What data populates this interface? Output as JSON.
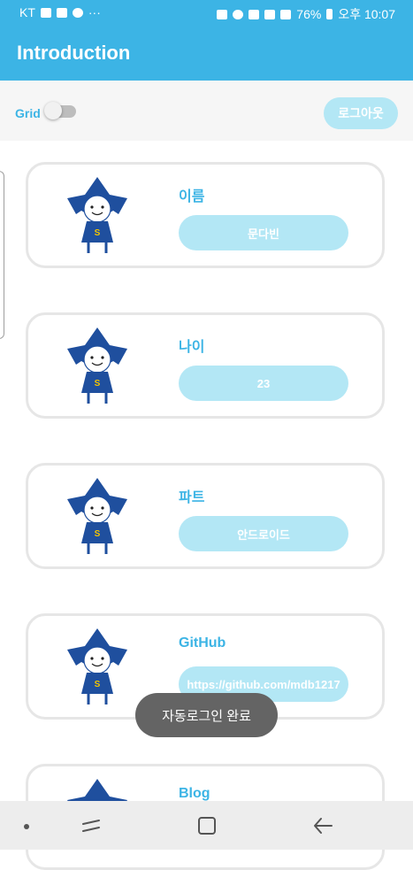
{
  "status_bar": {
    "carrier": "KT",
    "more": "···",
    "battery": "76%",
    "time": "오후 10:07"
  },
  "app_bar": {
    "title": "Introduction"
  },
  "toolbar": {
    "grid_label": "Grid",
    "grid_on": false,
    "logout_label": "로그아웃"
  },
  "cards": [
    {
      "title": "이름",
      "value": "문다빈"
    },
    {
      "title": "나이",
      "value": "23"
    },
    {
      "title": "파트",
      "value": "안드로이드"
    },
    {
      "title": "GitHub",
      "value": "https://github.com/mdb1217"
    },
    {
      "title": "Blog",
      "value": ""
    }
  ],
  "toast": {
    "message": "자동로그인 완료"
  },
  "colors": {
    "accent": "#3cb4e5",
    "pill": "#b3e7f5",
    "mascot": "#1f4f9e"
  }
}
